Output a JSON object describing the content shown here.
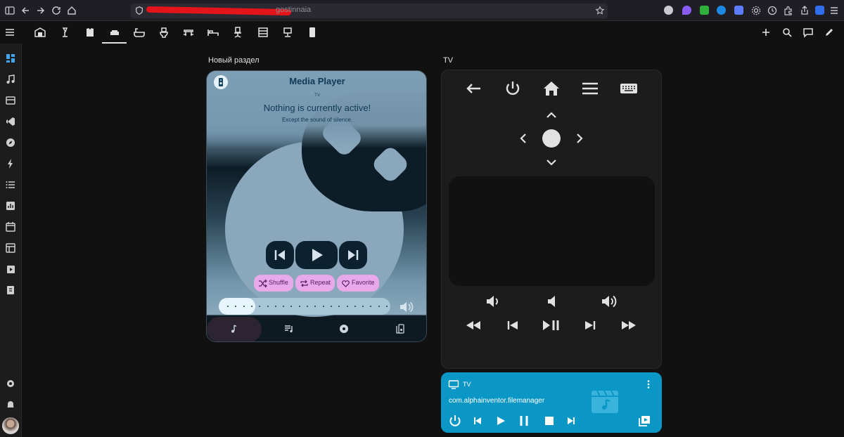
{
  "browser": {
    "url_visible_text": "gostinnaia"
  },
  "sections": {
    "media_title": "Новый раздел",
    "remote_title": "TV"
  },
  "media_player": {
    "title": "Media Player",
    "source": "TV",
    "status": "Nothing is currently active!",
    "subtitle": "Except the sound of silence.",
    "chips": {
      "shuffle": "Shuffle",
      "repeat": "Repeat",
      "favorite": "Favorite"
    },
    "volume_fraction": 0.13,
    "colors": {
      "chip": "#e9a8ea",
      "accent": "#0d3a57"
    }
  },
  "tv_card": {
    "name": "TV",
    "app": "com.alphainventor.filemanager",
    "color": "#0b97c6"
  }
}
